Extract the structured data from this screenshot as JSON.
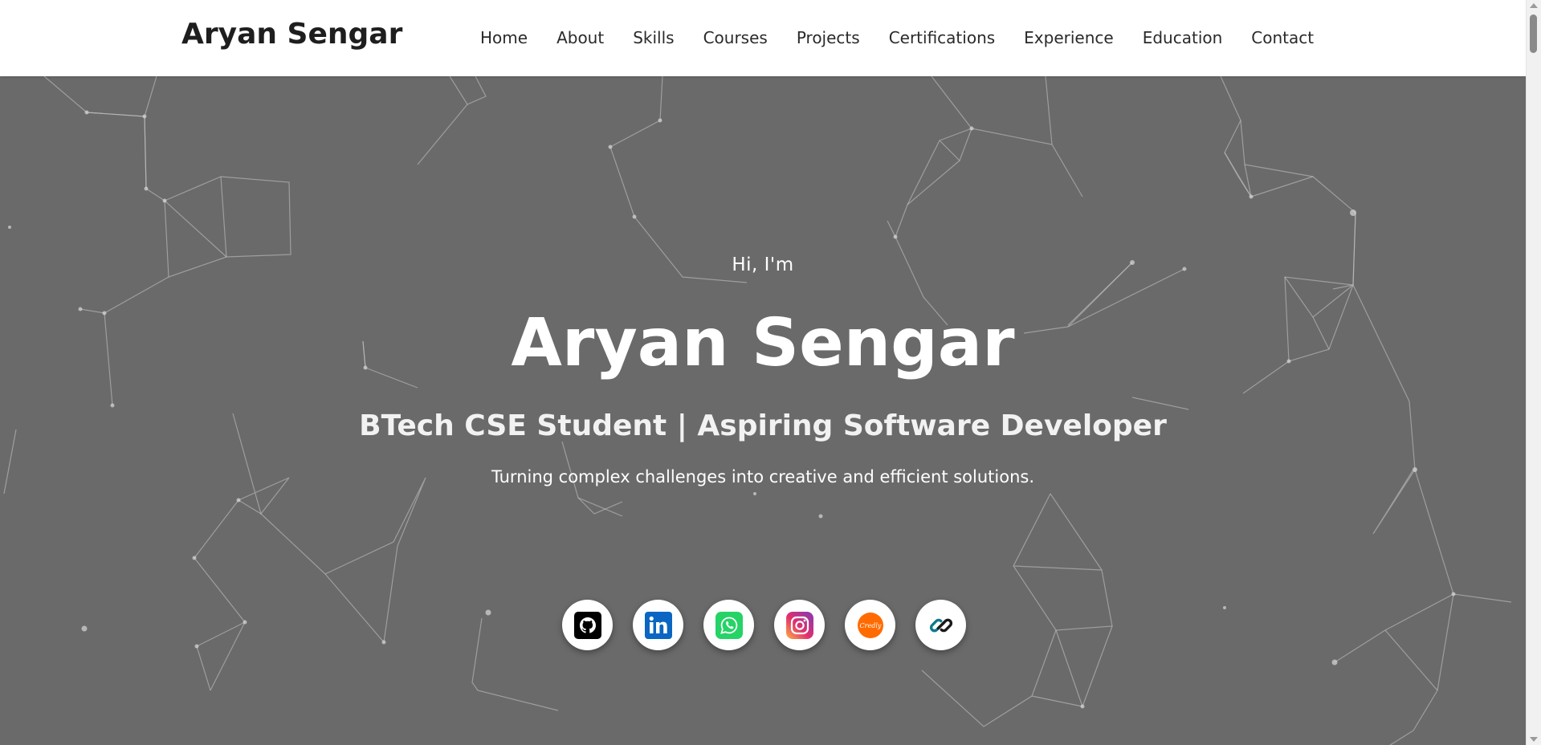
{
  "header": {
    "brand": "Aryan Sengar",
    "nav": [
      {
        "label": "Home"
      },
      {
        "label": "About"
      },
      {
        "label": "Skills"
      },
      {
        "label": "Courses"
      },
      {
        "label": "Projects"
      },
      {
        "label": "Certifications"
      },
      {
        "label": "Experience"
      },
      {
        "label": "Education"
      },
      {
        "label": "Contact"
      }
    ]
  },
  "hero": {
    "greeting": "Hi, I'm",
    "name": "Aryan Sengar",
    "role": "BTech CSE Student | Aspiring Software Developer",
    "tagline": "Turning complex challenges into creative and efficient solutions.",
    "background_color": "#6a6a6a",
    "socials": [
      {
        "icon": "github-icon",
        "color": "#000000"
      },
      {
        "icon": "linkedin-icon",
        "color": "#0a66c2"
      },
      {
        "icon": "whatsapp-icon",
        "color": "#25d366"
      },
      {
        "icon": "instagram-icon",
        "color": "#d6249f"
      },
      {
        "icon": "credly-icon",
        "color": "#ff6b00",
        "text": "Credly"
      },
      {
        "icon": "link-icon",
        "color": "#1a1a1a"
      }
    ]
  },
  "colors": {
    "header_bg": "#ffffff",
    "brand_text": "#1e1e1e",
    "nav_text": "#2a2a2a",
    "hero_text": "#ffffff"
  }
}
